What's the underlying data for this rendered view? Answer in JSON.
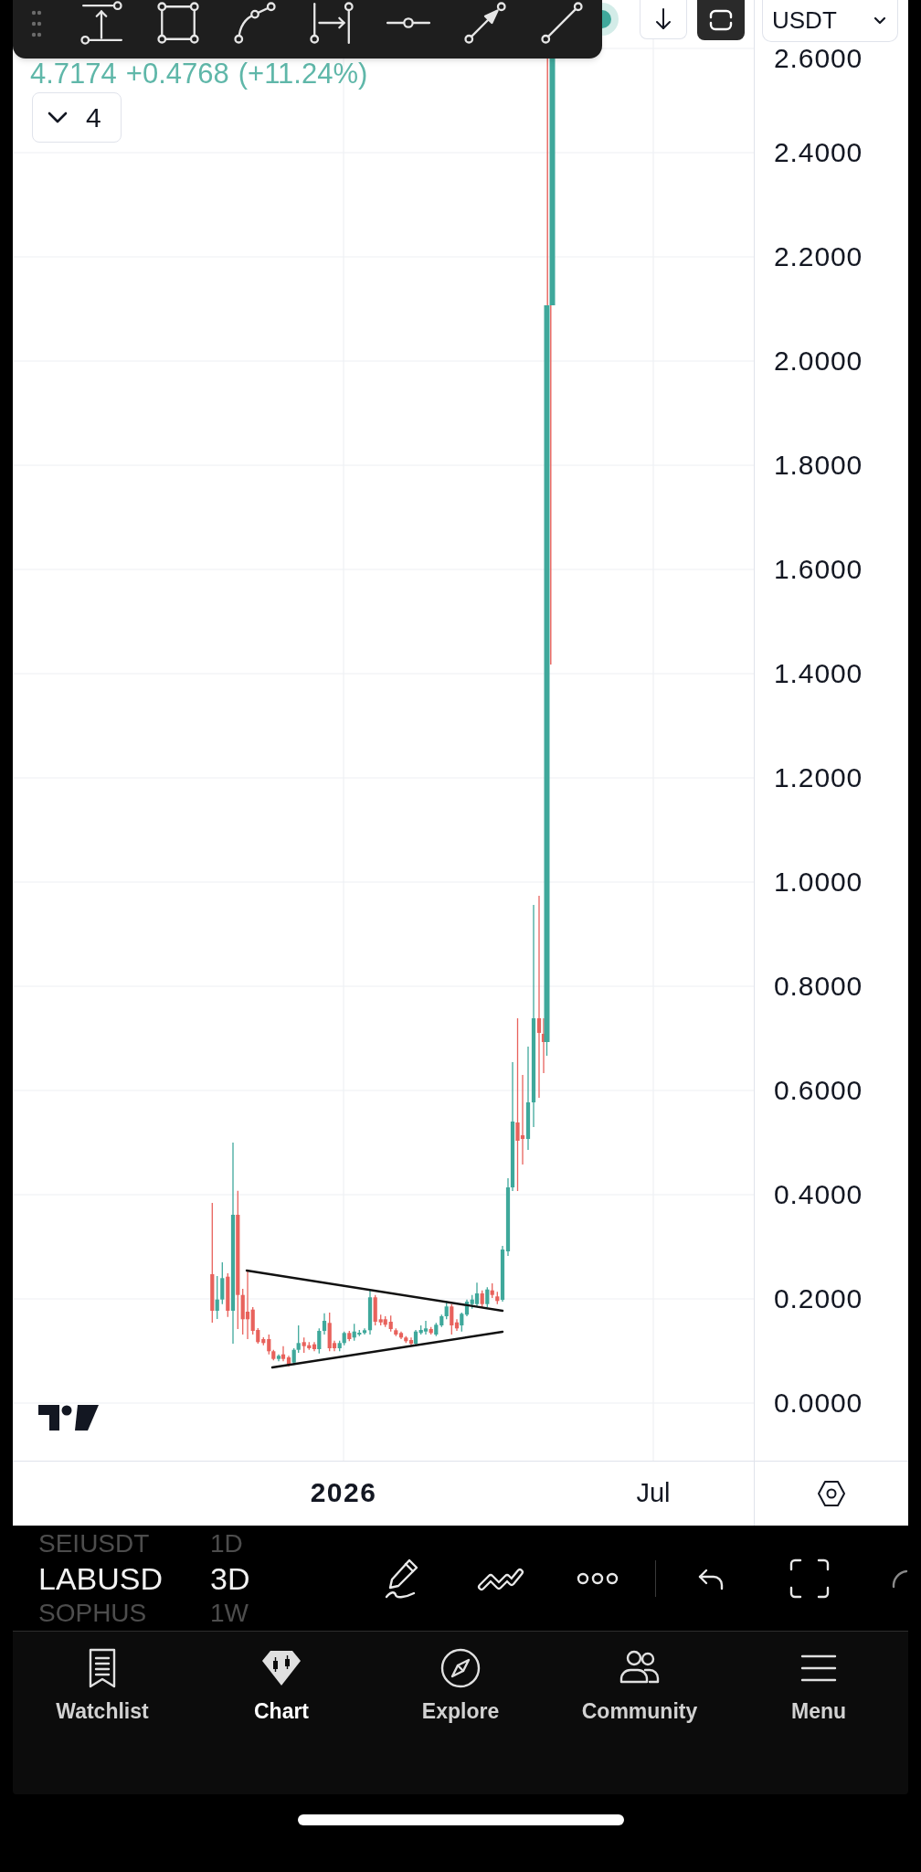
{
  "currency_selector": {
    "value": "USDT"
  },
  "legend": {
    "price": "4.7174",
    "change": "+0.4768",
    "change_percent": "(+11.24%)"
  },
  "indicators_toggle": {
    "count": "4",
    "expanded": false
  },
  "price_axis": {
    "labels": [
      "2.6000",
      "2.4000",
      "2.2000",
      "2.0000",
      "1.8000",
      "1.6000",
      "1.4000",
      "1.2000",
      "1.0000",
      "0.8000",
      "0.6000",
      "0.4000",
      "0.2000",
      "0.0000"
    ]
  },
  "time_axis": {
    "labels": [
      {
        "text": "2026",
        "kind": "year"
      },
      {
        "text": "Jul",
        "kind": "month"
      }
    ]
  },
  "symbol_picker": {
    "symbols": [
      {
        "label": "SEIUSDT",
        "selected": false
      },
      {
        "label": "LABUSD",
        "selected": true
      },
      {
        "label": "SOPHUS",
        "selected": false
      }
    ],
    "intervals": [
      {
        "label": "1D",
        "selected": false
      },
      {
        "label": "3D",
        "selected": true
      },
      {
        "label": "1W",
        "selected": false
      }
    ]
  },
  "bottom_nav": {
    "tabs": [
      {
        "label": "Watchlist",
        "selected": false
      },
      {
        "label": "Chart",
        "selected": true
      },
      {
        "label": "Explore",
        "selected": false
      },
      {
        "label": "Community",
        "selected": false
      },
      {
        "label": "Menu",
        "selected": false
      }
    ]
  }
}
